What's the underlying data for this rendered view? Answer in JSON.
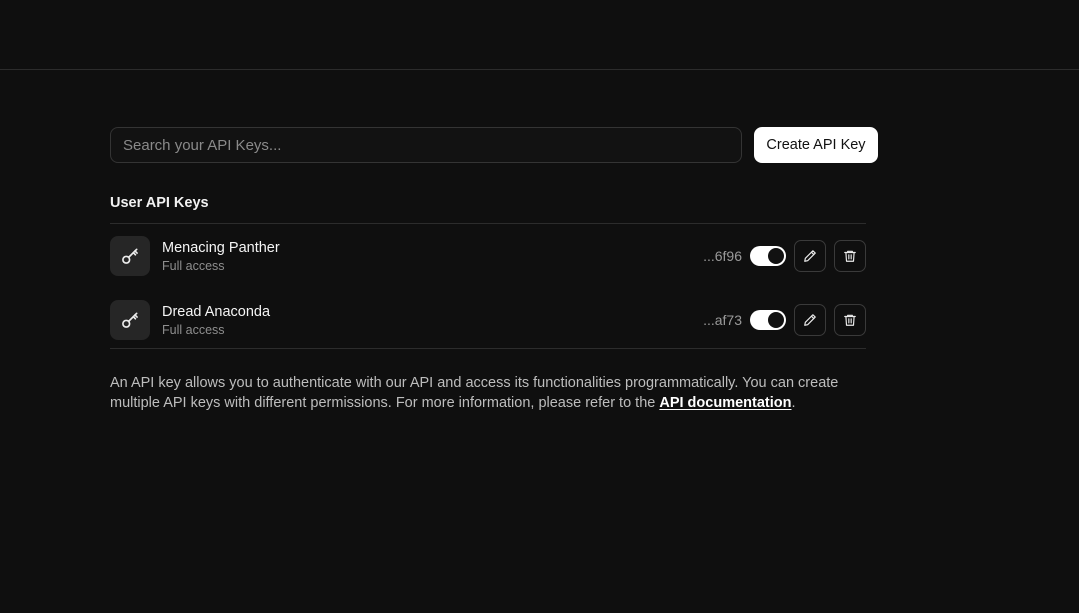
{
  "search": {
    "placeholder": "Search your API Keys..."
  },
  "actions": {
    "create_label": "Create API Key"
  },
  "section": {
    "title": "User API Keys"
  },
  "keys": [
    {
      "name": "Menacing Panther",
      "access": "Full access",
      "suffix": "...6f96",
      "enabled": true
    },
    {
      "name": "Dread Anaconda",
      "access": "Full access",
      "suffix": "...af73",
      "enabled": true
    }
  ],
  "description": {
    "text_before": "An API key allows you to authenticate with our API and access its functionalities programmatically. You can create multiple API keys with different permissions. For more information, please refer to the ",
    "link_text": "API documentation",
    "text_after": "."
  },
  "icons": {
    "avatar": "key-icon",
    "edit": "pencil-icon",
    "delete": "trash-icon"
  },
  "colors": {
    "background": "#0f0f0f",
    "primary_button": "#ffffff",
    "muted_text": "#8e8e8e"
  }
}
